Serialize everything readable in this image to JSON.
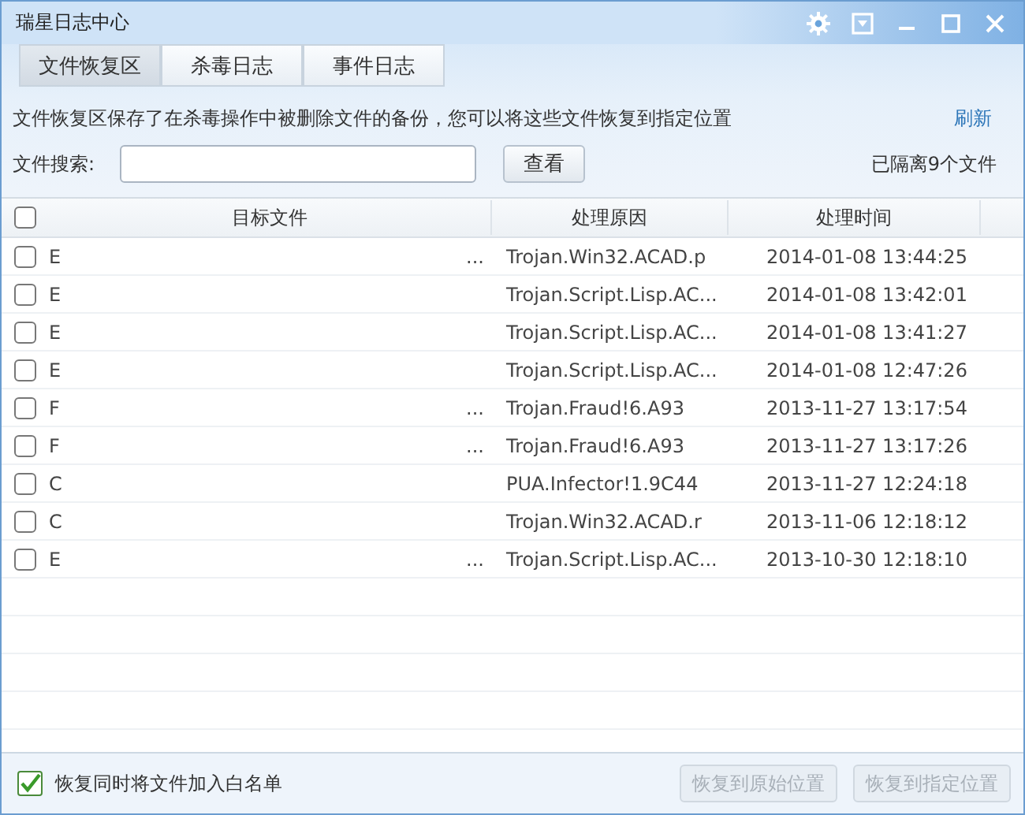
{
  "window": {
    "title": "瑞星日志中心"
  },
  "tabs": [
    {
      "label": "文件恢复区",
      "selected": true
    },
    {
      "label": "杀毒日志",
      "selected": false
    },
    {
      "label": "事件日志",
      "selected": false
    }
  ],
  "description": "文件恢复区保存了在杀毒操作中被删除文件的备份，您可以将这些文件恢复到指定位置",
  "refresh": "刷新",
  "search": {
    "label": "文件搜索:",
    "button": "查看"
  },
  "quarantine_count": "已隔离9个文件",
  "table": {
    "select_all": false,
    "columns": [
      "目标文件",
      "处理原因",
      "处理时间"
    ],
    "rows": [
      {
        "checked": false,
        "file": "E",
        "file_end": "...",
        "reason": "Trojan.Win32.ACAD.p",
        "time": "2014-01-08 13:44:25"
      },
      {
        "checked": false,
        "file": "E",
        "reason": "Trojan.Script.Lisp.AC...",
        "time": "2014-01-08 13:42:01"
      },
      {
        "checked": false,
        "file": "E",
        "reason": "Trojan.Script.Lisp.AC...",
        "time": "2014-01-08 13:41:27"
      },
      {
        "checked": false,
        "file": "E",
        "reason": "Trojan.Script.Lisp.AC...",
        "time": "2014-01-08 12:47:26"
      },
      {
        "checked": false,
        "file": "F",
        "file_end": "...",
        "reason": "Trojan.Fraud!6.A93",
        "time": "2013-11-27 13:17:54"
      },
      {
        "checked": false,
        "file": "F",
        "file_end": "...",
        "reason": "Trojan.Fraud!6.A93",
        "time": "2013-11-27 13:17:26"
      },
      {
        "checked": false,
        "file": "C",
        "reason": "PUA.Infector!1.9C44",
        "time": "2013-11-27 12:24:18"
      },
      {
        "checked": false,
        "file": "C",
        "reason": "Trojan.Win32.ACAD.r",
        "time": "2013-11-06 12:18:12"
      },
      {
        "checked": false,
        "file": "E",
        "file_end": "...",
        "reason": "Trojan.Script.Lisp.AC...",
        "time": "2013-10-30 12:18:10"
      }
    ]
  },
  "footer": {
    "whitelist": {
      "label": "恢复同时将文件加入白名单",
      "checked": true
    },
    "buttons": [
      {
        "label": "恢复到原始位置",
        "disabled": true
      },
      {
        "label": "恢复到指定位置",
        "disabled": true
      }
    ]
  }
}
